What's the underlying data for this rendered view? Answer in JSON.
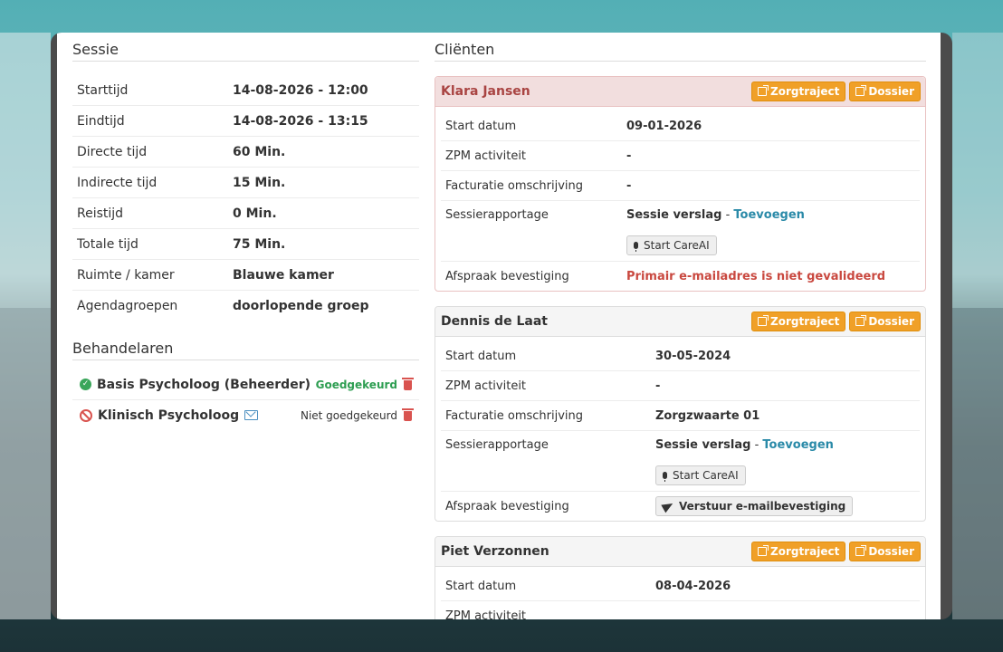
{
  "session": {
    "title": "Sessie",
    "rows": [
      {
        "label": "Starttijd",
        "value": "14-08-2026 - 12:00"
      },
      {
        "label": "Eindtijd",
        "value": "14-08-2026 - 13:15"
      },
      {
        "label": "Directe tijd",
        "value": "60 Min."
      },
      {
        "label": "Indirecte tijd",
        "value": "15 Min."
      },
      {
        "label": "Reistijd",
        "value": "0 Min."
      },
      {
        "label": "Totale tijd",
        "value": "75 Min."
      },
      {
        "label": "Ruimte / kamer",
        "value": "Blauwe kamer"
      },
      {
        "label": "Agendagroepen",
        "value": "doorlopende groep"
      }
    ]
  },
  "behandelaren": {
    "title": "Behandelaren",
    "items": [
      {
        "name": "Basis Psycholoog (Beheerder)",
        "status": "Goedgekeurd",
        "icon": "check-circle-icon"
      },
      {
        "name": "Klinisch Psycholoog",
        "status": "Niet goedgekeurd",
        "icon": "ban-icon"
      }
    ]
  },
  "clients": {
    "title": "Cliënten",
    "buttons": {
      "zorgtraject": "Zorgtraject",
      "dossier": "Dossier"
    },
    "labels": {
      "start": "Start datum",
      "zpm": "ZPM activiteit",
      "facturatie": "Facturatie omschrijving",
      "sessie": "Sessierapportage",
      "afspraak": "Afspraak bevestiging"
    },
    "sessie_verslag": "Sessie verslag",
    "separator": " - ",
    "toevoegen": "Toevoegen",
    "careai": "Start CareAI",
    "items": [
      {
        "name": "Klara Jansen",
        "start": "09-01-2026",
        "zpm": "-",
        "facturatie": "-",
        "afspraak": "Primair e-mailadres is niet gevalideerd"
      },
      {
        "name": "Dennis de Laat",
        "start": "30-05-2024",
        "zpm": "-",
        "facturatie": "Zorgzwaarte 01",
        "afspraak": "Verstuur e-mailbevestiging"
      },
      {
        "name": "Piet Verzonnen",
        "start": "08-04-2026"
      }
    ]
  },
  "colors": {
    "accent_orange": "#f0a028",
    "danger": "#a94442",
    "success": "#2e9e52",
    "link": "#2a8aa8"
  }
}
